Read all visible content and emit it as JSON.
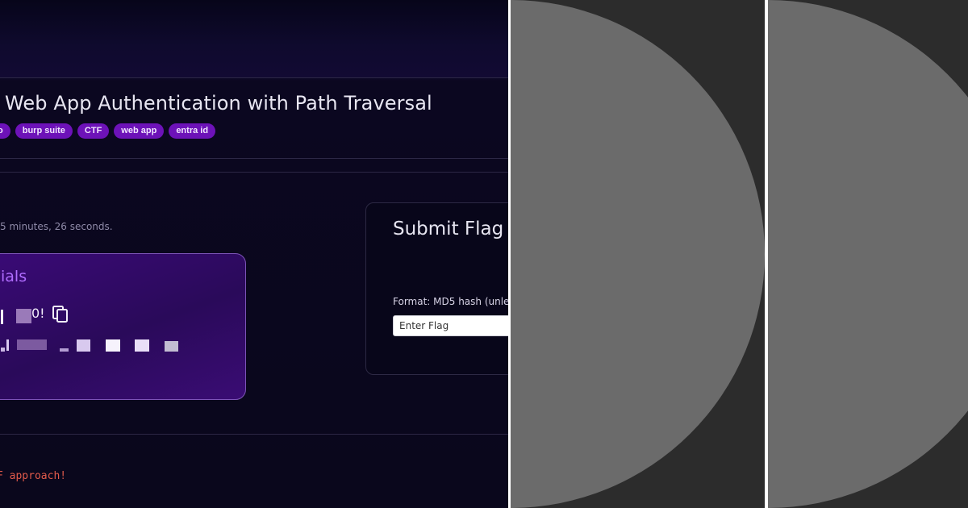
{
  "page": {
    "title": "Web App Authentication with Path Traversal",
    "tags": [
      "o",
      "burp suite",
      "CTF",
      "web app",
      "entra id"
    ],
    "time_text": "5 minutes, 26 seconds."
  },
  "credentials_card": {
    "title": "ials",
    "line1_fragment": "0!"
  },
  "submit_flag": {
    "title": "Submit Flag",
    "format_text": "Format: MD5 hash (unles",
    "input_placeholder": "Enter Flag"
  },
  "footer": {
    "text": "F approach!"
  },
  "colors": {
    "background": "#0a071c",
    "tag": "#6d12b8",
    "card_accent": "#b06cff",
    "footer_text": "#e05a4a",
    "panel_bg": "#2c2c2c",
    "panel_circle": "#6b6b6b"
  }
}
